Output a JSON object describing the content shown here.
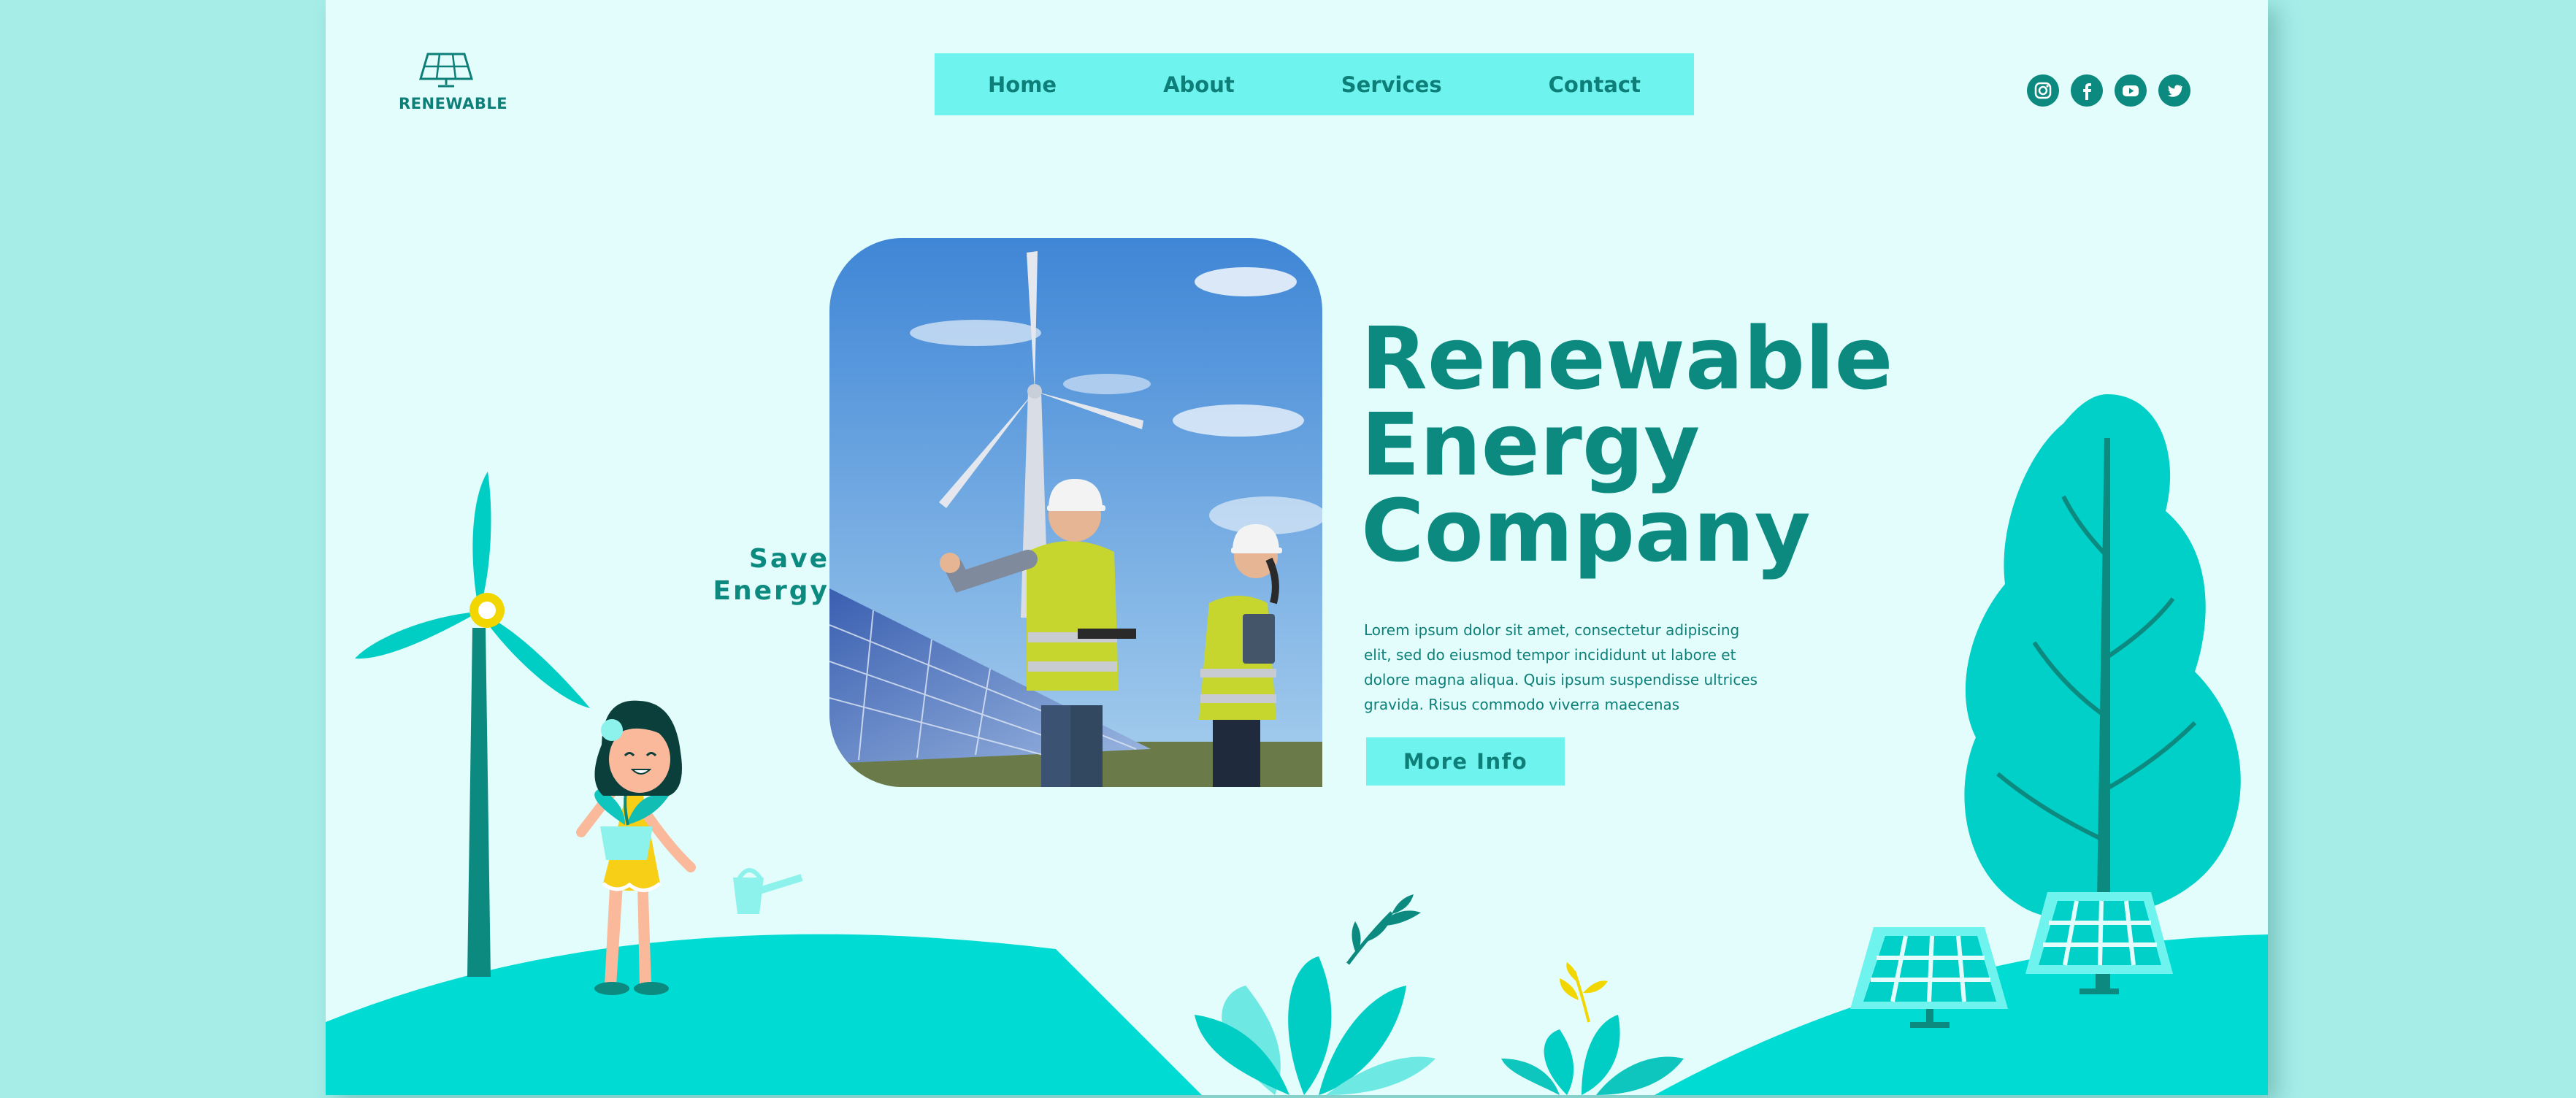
{
  "brand": {
    "name": "RENEWABLE",
    "logo_icon": "solar-panel-icon"
  },
  "nav": {
    "items": [
      {
        "label": "Home"
      },
      {
        "label": "About"
      },
      {
        "label": "Services"
      },
      {
        "label": "Contact"
      }
    ]
  },
  "social": [
    "instagram-icon",
    "facebook-icon",
    "youtube-icon",
    "twitter-icon"
  ],
  "hero": {
    "tagline_line1": "Save",
    "tagline_line2": "Energy",
    "headline_line1": "Renewable",
    "headline_line2": "Energy",
    "headline_line3": "Company",
    "body": "Lorem ipsum dolor sit amet, consectetur adipiscing elit, sed do eiusmod tempor incididunt ut labore et dolore magna aliqua. Quis ipsum suspendisse ultrices gravida. Risus commodo viverra maecenas",
    "cta_label": "More Info"
  },
  "colors": {
    "page_bg": "#e2fdfb",
    "outer_bg": "#a6ede8",
    "primary_text": "#0d8a80",
    "nav_bg": "#6ff3ee",
    "hills": "#00dcd4"
  }
}
